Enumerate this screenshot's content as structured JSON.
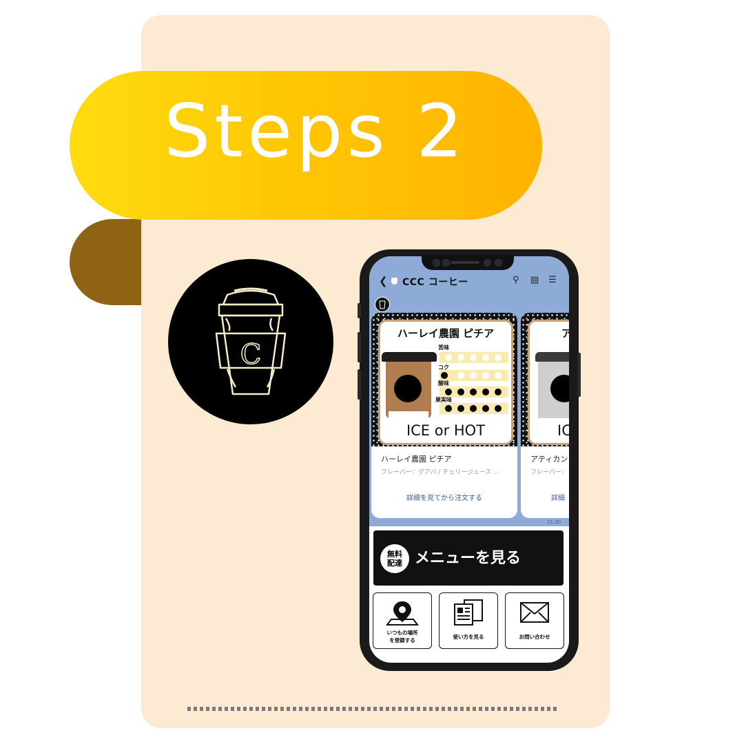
{
  "banner": {
    "title": "Steps 2"
  },
  "colors": {
    "banner_start": "#fedc10",
    "banner_end": "#ffb300",
    "card_bg": "#fcebd2",
    "chat_bg": "#8eabd7",
    "banner_shadow": "#8e6414"
  },
  "logo": {
    "letter": "C"
  },
  "phone": {
    "header": {
      "back_icon": "chevron-left-icon",
      "title": "CCC コーヒー",
      "icons": [
        "search-icon",
        "note-icon",
        "menu-icon"
      ]
    },
    "messages": [
      {
        "image_title": "ハーレイ農園 ピチア",
        "flavors": [
          {
            "label": "苦味",
            "level": 0
          },
          {
            "label": "コク",
            "level": 1
          },
          {
            "label": "酸味",
            "level": 5
          },
          {
            "label": "果実味",
            "level": 5
          }
        ],
        "temp_label": "ICE or HOT",
        "name": "ハーレイ農園 ピチア",
        "description": "フレーバー：グアバ / チェリージュース ...",
        "button": "詳細を見てから注文する"
      },
      {
        "image_title": "アテ",
        "temp_label": "IC",
        "name": "アティカン",
        "description": "フレーバー：",
        "button": "詳細"
      }
    ],
    "timestamp": "21:30",
    "rich_menu": {
      "badge": "無料\n配達",
      "main_label": "メニューを見る",
      "tiles": [
        {
          "icon": "map-pin-icon",
          "label": "いつもの場所\nを登録する"
        },
        {
          "icon": "document-icon",
          "label": "使い方を見る"
        },
        {
          "icon": "envelope-icon",
          "label": "お問い合わせ"
        }
      ]
    }
  }
}
